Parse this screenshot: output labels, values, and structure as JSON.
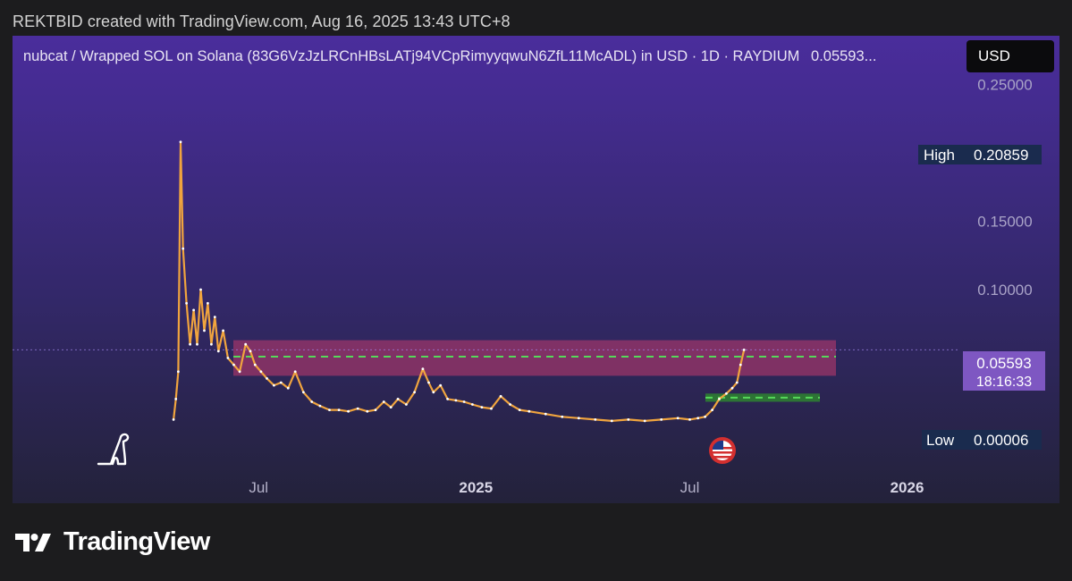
{
  "attribution": "REKTBID created with TradingView.com, Aug 16, 2025 13:43 UTC+8",
  "header": {
    "symbol_text": "nubcat / Wrapped SOL on Solana (83G6VzJzLRCnHBsLATj94VCpRimyyqwuN6ZfL11McADL) in USD · 1D · RAYDIUM",
    "last_price": "0.05593",
    "ellipsis": "...",
    "currency_button": "USD"
  },
  "brand": {
    "name": "TradingView",
    "icon": "tradingview-logo-icon"
  },
  "colors": {
    "background_top": "#4a2d9c",
    "background_bottom": "#23223a",
    "candle": "#f0a43e",
    "wick": "#ffffff",
    "resistance_zone": "#c33a6e",
    "zone_line": "#56d95a",
    "support_zone": "#2e7d32",
    "price_tag": "#7e57c2",
    "high_low_tag": "#1a2b4e"
  },
  "icons": [
    "dinosaur-icon",
    "us-flag-event-icon",
    "tradingview-logo-icon"
  ],
  "chart_data": {
    "type": "line",
    "title": "nubcat / Wrapped SOL on Solana (83G6VzJzLRCnHBsLATj94VCpRimyyqwuN6ZfL11McADL) in USD · 1D · RAYDIUM",
    "xlabel": "",
    "ylabel": "",
    "x_ticks": [
      "Jul",
      "2025",
      "Jul",
      "2026"
    ],
    "y_ticks": [
      "0.25000",
      "0.20000",
      "0.15000",
      "0.10000"
    ],
    "ylim": [
      0,
      0.26
    ],
    "grid": false,
    "series": [
      {
        "x": [
          "2024-04-20",
          "2024-04-22",
          "2024-04-24",
          "2024-04-26",
          "2024-04-28",
          "2024-05-01",
          "2024-05-04",
          "2024-05-07",
          "2024-05-10",
          "2024-05-13",
          "2024-05-16",
          "2024-05-19",
          "2024-05-22",
          "2024-05-25",
          "2024-05-28",
          "2024-06-01",
          "2024-06-05",
          "2024-06-10",
          "2024-06-15",
          "2024-06-20",
          "2024-06-24",
          "2024-06-28",
          "2024-07-03",
          "2024-07-08",
          "2024-07-14",
          "2024-07-20",
          "2024-07-26",
          "2024-08-01",
          "2024-08-08",
          "2024-08-15",
          "2024-08-22",
          "2024-08-30",
          "2024-09-07",
          "2024-09-15",
          "2024-09-23",
          "2024-10-01",
          "2024-10-08",
          "2024-10-15",
          "2024-10-21",
          "2024-10-27",
          "2024-11-03",
          "2024-11-10",
          "2024-11-17",
          "2024-11-22",
          "2024-11-26",
          "2024-12-02",
          "2024-12-08",
          "2024-12-15",
          "2024-12-22",
          "2024-12-29",
          "2025-01-06",
          "2025-01-14",
          "2025-01-22",
          "2025-01-30",
          "2025-02-07",
          "2025-02-15",
          "2025-03-01",
          "2025-03-15",
          "2025-03-29",
          "2025-04-12",
          "2025-04-26",
          "2025-05-10",
          "2025-05-24",
          "2025-06-07",
          "2025-06-21",
          "2025-07-01",
          "2025-07-08",
          "2025-07-14",
          "2025-07-20",
          "2025-07-26",
          "2025-08-01",
          "2025-08-06",
          "2025-08-10",
          "2025-08-13",
          "2025-08-16"
        ],
        "y": [
          0.005,
          0.02,
          0.04,
          0.208,
          0.13,
          0.09,
          0.06,
          0.085,
          0.06,
          0.1,
          0.07,
          0.09,
          0.06,
          0.08,
          0.055,
          0.07,
          0.05,
          0.045,
          0.04,
          0.06,
          0.055,
          0.045,
          0.04,
          0.035,
          0.03,
          0.032,
          0.028,
          0.04,
          0.025,
          0.018,
          0.015,
          0.012,
          0.012,
          0.011,
          0.013,
          0.011,
          0.012,
          0.018,
          0.014,
          0.02,
          0.016,
          0.025,
          0.042,
          0.032,
          0.025,
          0.03,
          0.02,
          0.019,
          0.018,
          0.016,
          0.014,
          0.013,
          0.022,
          0.016,
          0.012,
          0.011,
          0.009,
          0.007,
          0.006,
          0.005,
          0.004,
          0.005,
          0.004,
          0.005,
          0.006,
          0.005,
          0.006,
          0.007,
          0.012,
          0.02,
          0.024,
          0.028,
          0.032,
          0.045,
          0.05593
        ]
      }
    ],
    "high": "0.20859",
    "low": "0.00006",
    "last": "0.05593",
    "countdown": "18:16:33",
    "high_label": "High",
    "low_label": "Low",
    "resistance_zone": [
      0.037,
      0.063
    ],
    "resistance_line": 0.051,
    "support_zone": [
      0.018,
      0.024
    ],
    "support_line": 0.021
  }
}
